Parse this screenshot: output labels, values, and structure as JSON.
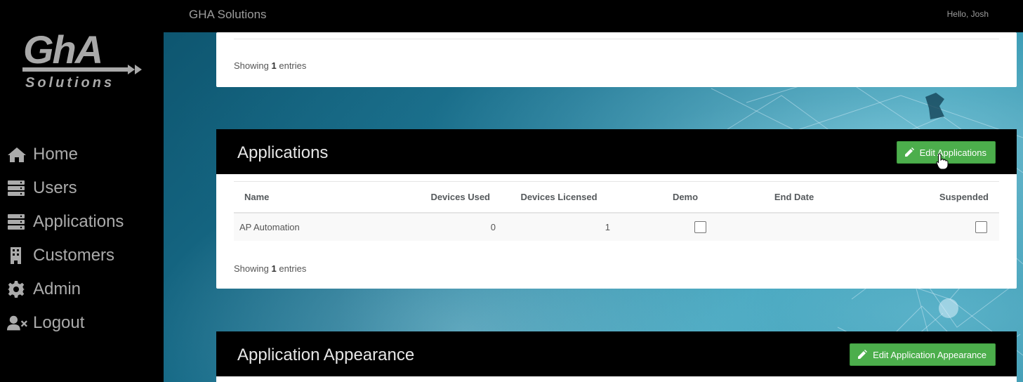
{
  "header": {
    "brand": "GHA Solutions",
    "greeting": "Hello, Josh"
  },
  "logo": {
    "text_top": "GhA",
    "text_bottom": "Solutions"
  },
  "sidebar": {
    "items": [
      {
        "label": "Home",
        "icon": "home-icon"
      },
      {
        "label": "Users",
        "icon": "server-icon"
      },
      {
        "label": "Applications",
        "icon": "server-icon"
      },
      {
        "label": "Customers",
        "icon": "building-icon"
      },
      {
        "label": "Admin",
        "icon": "gear-icon"
      },
      {
        "label": "Logout",
        "icon": "user-times-icon"
      }
    ]
  },
  "top_panel": {
    "showing_prefix": "Showing",
    "showing_count": "1",
    "showing_suffix": "entries"
  },
  "applications_panel": {
    "title": "Applications",
    "edit_button": "Edit Applications",
    "columns": [
      "Name",
      "Devices Used",
      "Devices Licensed",
      "Demo",
      "End Date",
      "Suspended"
    ],
    "rows": [
      {
        "name": "AP Automation",
        "devices_used": "0",
        "devices_licensed": "1",
        "demo": false,
        "end_date": "",
        "suspended": false
      }
    ],
    "showing_prefix": "Showing",
    "showing_count": "1",
    "showing_suffix": "entries"
  },
  "appearance_panel": {
    "title": "Application Appearance",
    "edit_button": "Edit Application Appearance"
  },
  "colors": {
    "accent_green": "#4cae4c",
    "sidebar_bg": "#000000",
    "nav_text": "#ababab"
  }
}
